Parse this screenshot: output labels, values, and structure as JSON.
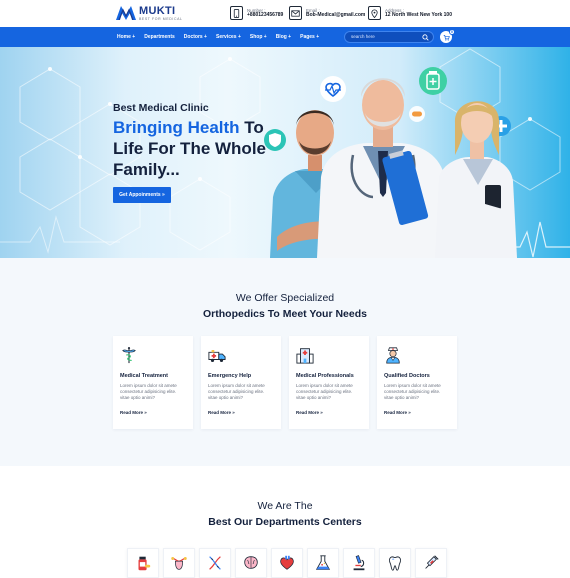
{
  "brand": {
    "name": "MUKTI",
    "tagline": "BEST FOR MEDICAL",
    "primary_color": "#1565e0",
    "dark_color": "#14213d"
  },
  "contacts": [
    {
      "icon": "phone-icon",
      "label": "Number :",
      "value": "+880123456789"
    },
    {
      "icon": "email-icon",
      "label": "Email :",
      "value": "Bob-Medical@gmail.com"
    },
    {
      "icon": "location-icon",
      "label": "Address :",
      "value": "12 North West New York 100"
    }
  ],
  "nav": {
    "items": [
      "Home +",
      "Departments",
      "Doctors +",
      "Services +",
      "Shop +",
      "Blog +",
      "Pages +"
    ],
    "search_placeholder": "search here",
    "cart_count": "0"
  },
  "hero": {
    "subtitle": "Best Medical Clinic",
    "title_accent": "Bringing Health",
    "title_rest": " To Life For The Whole Family...",
    "button_label": "Get Appoinments »"
  },
  "offer": {
    "subtitle": "We Offer Specialized",
    "title": "Orthopedics To Meet Your Needs",
    "cards": [
      {
        "icon": "caduceus-icon",
        "title": "Medical Treatment",
        "text": "Lorem ipsum dolor sit amete consectetur adipisicing elite. vitae optio animi?",
        "link": "Read More »"
      },
      {
        "icon": "ambulance-icon",
        "title": "Emergency Help",
        "text": "Lorem ipsum dolor sit amete consectetur adipisicing elite. vitae optio animi?",
        "link": "Read More »"
      },
      {
        "icon": "hospital-icon",
        "title": "Medical Professionals",
        "text": "Lorem ipsum dolor sit amete consectetur adipisicing elite. vitae optio animi?",
        "link": "Read More »"
      },
      {
        "icon": "nurse-icon",
        "title": "Qualified Doctors",
        "text": "Lorem ipsum dolor sit amete consectetur adipisicing elite. vitae optio animi?",
        "link": "Read More »"
      }
    ]
  },
  "departments": {
    "subtitle": "We Are The",
    "title": "Best Our Departments Centers",
    "icons": [
      "medicine-icon",
      "uterus-icon",
      "dna-icon",
      "brain-icon",
      "heart-icon",
      "lab-flask-icon",
      "microscope-icon",
      "tooth-icon",
      "syringe-icon"
    ]
  }
}
